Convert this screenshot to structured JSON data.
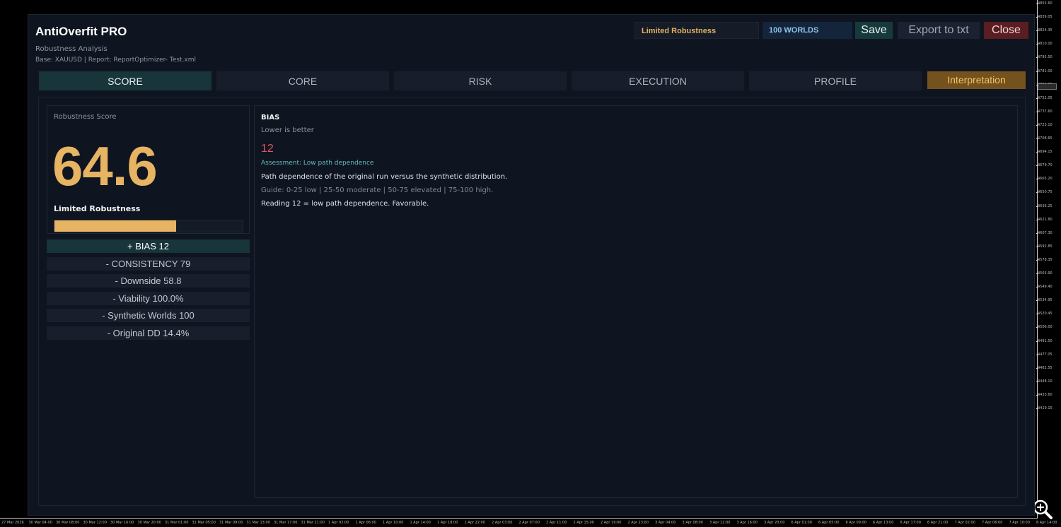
{
  "chart_bg": {
    "price_ticks": [
      "4855.60",
      "4839.05",
      "4824.35",
      "4810.00",
      "4795.50",
      "4781.00",
      "4766.55",
      "4752.05",
      "4737.60",
      "4723.10",
      "4708.65",
      "4694.15",
      "4679.70",
      "4665.20",
      "4650.75",
      "4636.25",
      "4621.80",
      "4607.30",
      "4592.85",
      "4578.35",
      "4563.90",
      "4549.40",
      "4534.95",
      "4520.45",
      "4506.00",
      "4491.50",
      "4477.05",
      "4462.55",
      "4448.10",
      "4433.60",
      "4419.15"
    ],
    "time_ticks": [
      "27 Mar 2026",
      "30 Mar 04:00",
      "30 Mar 08:00",
      "30 Mar 12:00",
      "30 Mar 16:00",
      "30 Mar 20:00",
      "31 Mar 01:00",
      "31 Mar 05:00",
      "31 Mar 09:00",
      "31 Mar 13:00",
      "31 Mar 17:00",
      "31 Mar 21:00",
      "1 Apr 02:00",
      "1 Apr 06:00",
      "1 Apr 10:00",
      "1 Apr 14:00",
      "1 Apr 18:00",
      "1 Apr 22:00",
      "2 Apr 03:00",
      "2 Apr 07:00",
      "2 Apr 11:00",
      "2 Apr 15:00",
      "2 Apr 19:00",
      "2 Apr 23:00",
      "3 Apr 04:00",
      "3 Apr 08:00",
      "3 Apr 12:00",
      "3 Apr 16:00",
      "3 Apr 20:00",
      "6 Apr 01:00",
      "6 Apr 05:00",
      "6 Apr 09:00",
      "6 Apr 13:00",
      "6 Apr 17:00",
      "6 Apr 21:00",
      "7 Apr 02:00",
      "7 Apr 06:00",
      "7 Apr 10:00",
      "8 Apr 14:00"
    ]
  },
  "header": {
    "title": "AntiOverfit PRO",
    "subtitle": "Robustness Analysis",
    "base_info": "Base: XAUUSD | Report: ReportOptimizer- Test.xml",
    "robustness_badge": "Limited Robustness",
    "worlds_badge": "100 WORLDS",
    "save_label": "Save",
    "export_label": "Export to txt",
    "close_label": "Close"
  },
  "tabs": [
    {
      "label": "SCORE",
      "active": true
    },
    {
      "label": "CORE",
      "active": false
    },
    {
      "label": "RISK",
      "active": false
    },
    {
      "label": "EXECUTION",
      "active": false
    },
    {
      "label": "PROFILE",
      "active": false
    }
  ],
  "interpretation_label": "Interpretation",
  "score": {
    "label": "Robustness Score",
    "value": "64.6",
    "status": "Limited Robustness",
    "bar_fraction": 0.646
  },
  "metrics": [
    {
      "label": "+ BIAS  12",
      "active": true
    },
    {
      "label": "- CONSISTENCY  79",
      "active": false
    },
    {
      "label": "- Downside  58.8",
      "active": false
    },
    {
      "label": "- Viability  100.0%",
      "active": false
    },
    {
      "label": "- Synthetic Worlds  100",
      "active": false
    },
    {
      "label": "- Original DD  14.4%",
      "active": false
    }
  ],
  "detail": {
    "title": "BIAS",
    "hint": "Lower is better",
    "value": "12",
    "assessment": "Assessment: Low path dependence",
    "description": "Path dependence of the original run versus the synthetic distribution.",
    "guide": "Guide: 0-25 low | 25-50 moderate | 50-75 elevated | 75-100 high.",
    "reading": "Reading 12 = low path dependence. Favorable."
  },
  "colors": {
    "accent_gold": "#e6b462",
    "accent_teal": "#17353a",
    "value_red": "#d9585e",
    "assessment_teal": "#5fbcbf"
  }
}
